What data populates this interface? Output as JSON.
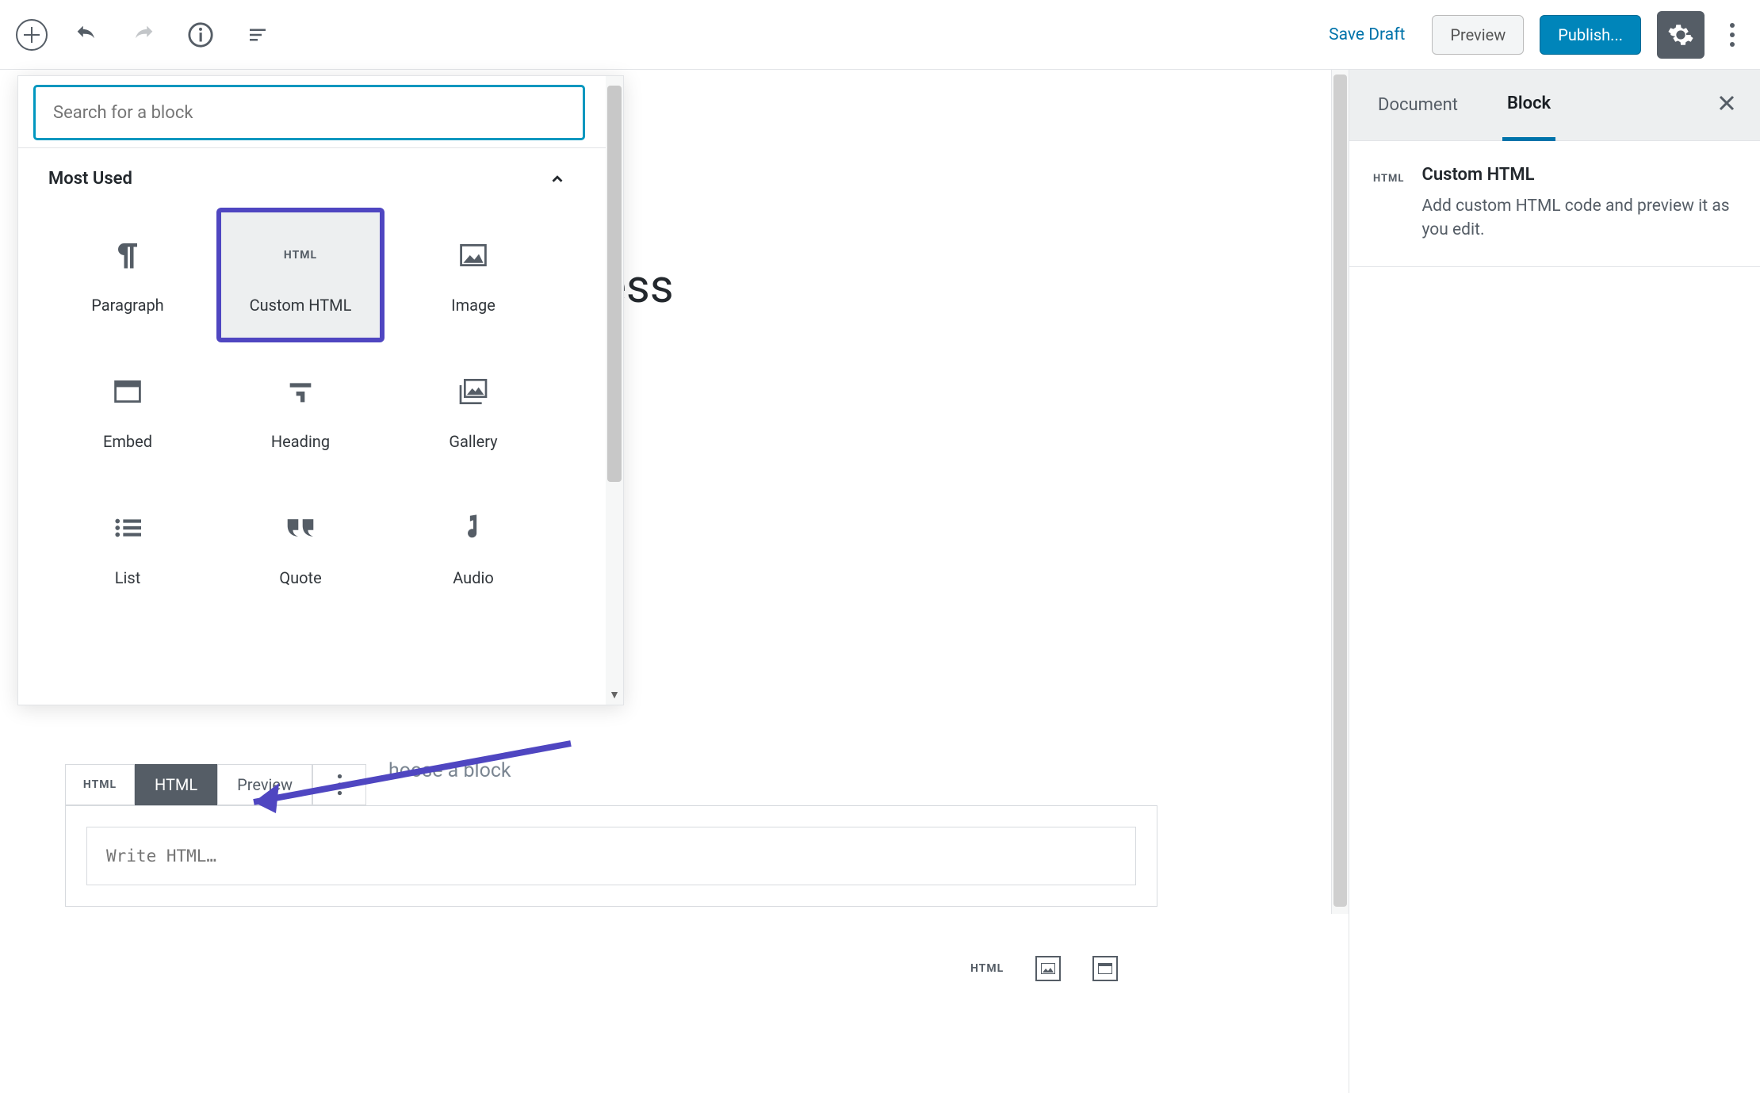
{
  "topbar": {
    "save_draft": "Save Draft",
    "preview": "Preview",
    "publish": "Publish..."
  },
  "inserter": {
    "search_placeholder": "Search for a block",
    "section_title": "Most Used",
    "blocks": {
      "paragraph": "Paragraph",
      "custom_html": "Custom HTML",
      "image": "Image",
      "embed": "Embed",
      "heading": "Heading",
      "gallery": "Gallery",
      "list": "List",
      "quote": "Quote",
      "audio": "Audio"
    }
  },
  "canvas": {
    "title_fragment": "ress",
    "choose_fragment": "hoose a block",
    "block_toolbar": {
      "html_tab": "HTML",
      "preview_tab": "Preview"
    },
    "html_placeholder": "Write HTML…",
    "html_badge": "HTML"
  },
  "sidebar": {
    "tab_document": "Document",
    "tab_block": "Block",
    "block_title": "Custom HTML",
    "block_desc": "Add custom HTML code and preview it as you edit."
  }
}
